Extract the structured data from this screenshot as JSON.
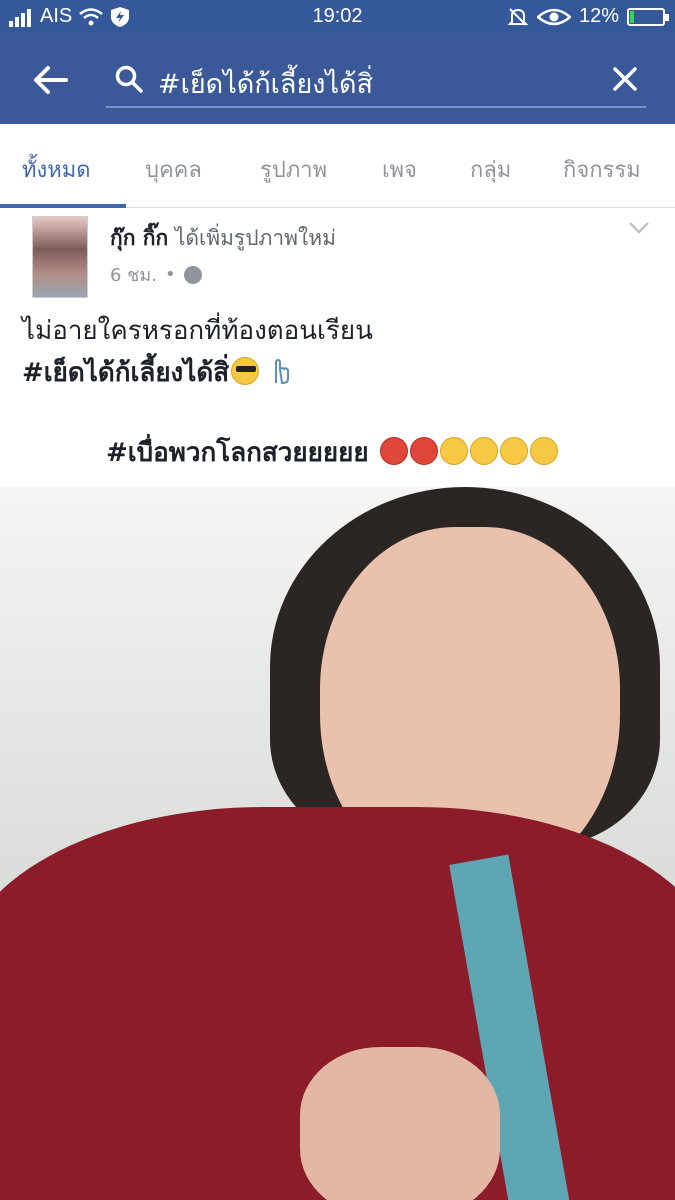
{
  "status": {
    "carrier": "AIS",
    "time": "19:02",
    "battery": "12%",
    "battery_level": 0.12
  },
  "search": {
    "query": "#เย็ดได้ก้เลี้ยงได้สิ่"
  },
  "tabs": [
    {
      "label": "ทั้งหมด"
    },
    {
      "label": "บุคคล"
    },
    {
      "label": "รูปภาพ"
    },
    {
      "label": "เพจ"
    },
    {
      "label": "กลุ่ม"
    },
    {
      "label": "กิจกรรม"
    }
  ],
  "post": {
    "author": "กุ๊ก กิ๊ก",
    "action": "ได้เพิ่มรูปภาพใหม่",
    "time": "6 ชม.",
    "line1": "ไม่อายใครหรอกที่ท้องตอนเรียน",
    "line2": "#เย็ดได้ก้เลี้ยงได้สิ่",
    "line3": "#เบื่อพวกโลกสวยยยยย"
  }
}
